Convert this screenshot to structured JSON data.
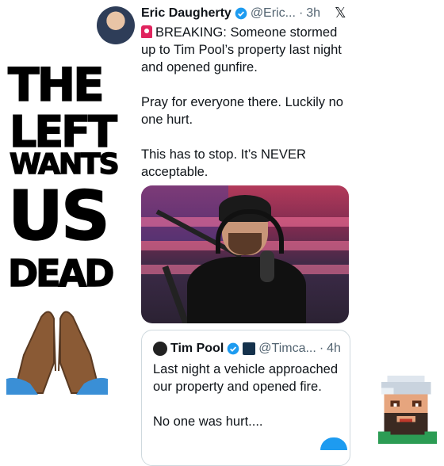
{
  "slogan": {
    "line1": "THE",
    "line2": "LEFT",
    "line3": "WANTS",
    "line4": "US",
    "line5": "DEAD"
  },
  "tweet": {
    "name": "Eric Daugherty",
    "handle": "@Eric...",
    "separator": "·",
    "time": "3h",
    "x_logo": "𝕏",
    "paragraphs": [
      "BREAKING: Someone stormed up to Tim Pool’s property last night and opened gunfire.",
      "Pray for everyone there. Luckily no one hurt.",
      "This has to stop. It’s NEVER acceptable."
    ]
  },
  "quote": {
    "name": "Tim Pool",
    "handle": "@Timca...",
    "separator": "·",
    "time": "4h",
    "paragraphs": [
      "Last night a vehicle approached our property and opened fire.",
      "No one was hurt...."
    ]
  },
  "colors": {
    "verified": "#1d9bf0",
    "secondary_text": "#536471",
    "border": "#cfd9de",
    "accent_blue": "#1d9bf0"
  },
  "icons": {
    "verified": "verified-badge-icon",
    "siren": "police-light-icon",
    "x": "x-logo-icon",
    "pray": "praying-hands-icon"
  }
}
